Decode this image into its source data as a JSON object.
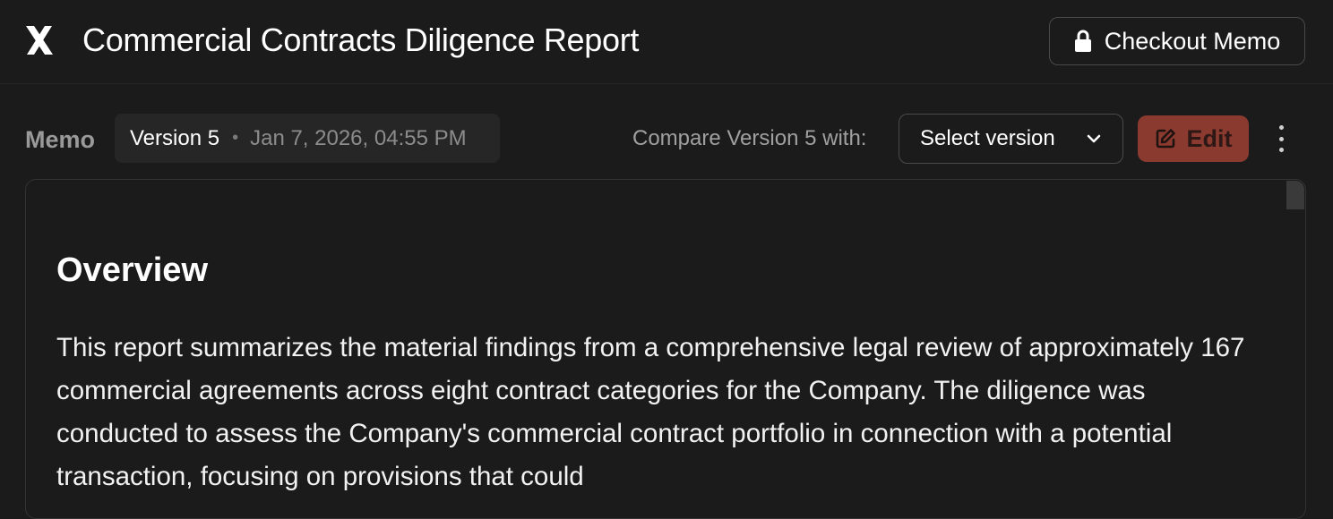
{
  "header": {
    "logo_icon": "x-logo-icon",
    "title": "Commercial Contracts Diligence Report",
    "checkout_label": "Checkout Memo",
    "checkout_icon": "lock-icon"
  },
  "toolbar": {
    "memo_label": "Memo",
    "version_name": "Version 5",
    "version_separator": "•",
    "version_date": "Jan 7, 2026, 04:55 PM",
    "compare_label": "Compare Version 5 with:",
    "select_version_label": "Select version",
    "edit_label": "Edit",
    "edit_icon": "edit-icon",
    "more_icon": "more-vertical-icon",
    "edit_color": "#8a3a2e"
  },
  "document": {
    "heading": "Overview",
    "body": "This report summarizes the material findings from a comprehensive legal review of approximately 167 commercial agreements across eight contract categories for the Company. The diligence was conducted to assess the Company's commercial contract portfolio in connection with a potential transaction, focusing on provisions that could"
  }
}
